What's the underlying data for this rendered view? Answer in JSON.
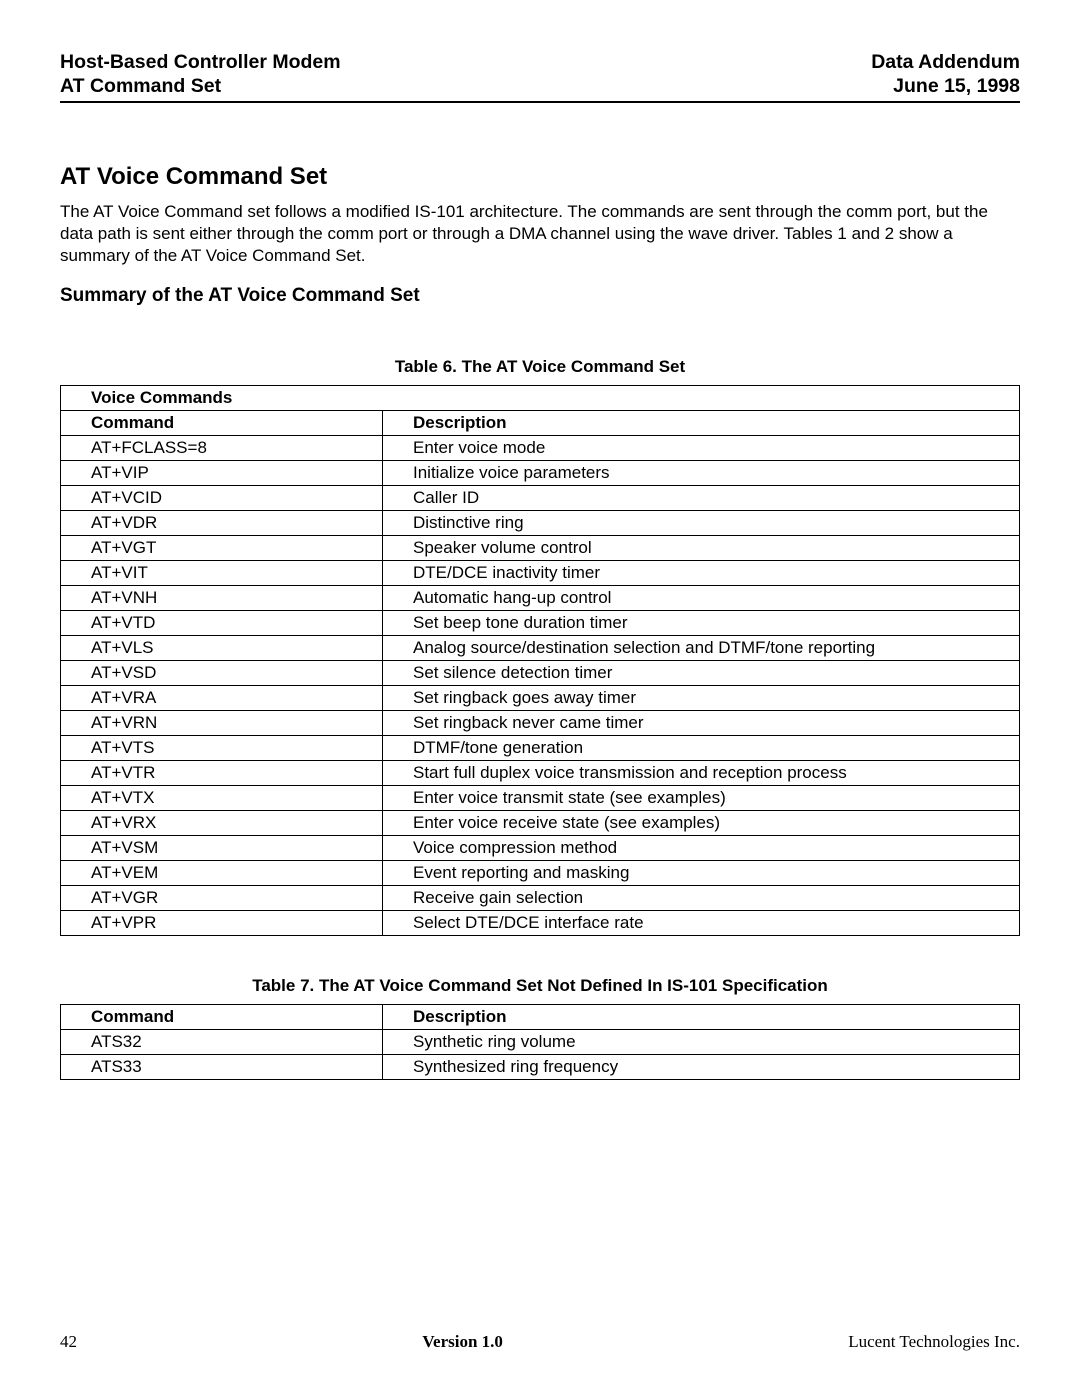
{
  "header": {
    "left_line1": "Host-Based Controller Modem",
    "left_line2": "AT Command Set",
    "right_line1": "Data Addendum",
    "right_line2": "June 15, 1998"
  },
  "section_title": "AT Voice Command Set",
  "intro_text": "The AT Voice Command set follows a modified IS-101 architecture.  The commands are sent through the comm port, but the data path is sent either through the comm port or through a DMA channel using the wave driver.  Tables 1 and 2 show a summary of the AT Voice Command Set.",
  "subsection_title": "Summary of the AT Voice Command Set",
  "table6": {
    "caption": "Table 6.  The AT Voice Command Set",
    "title_row": "Voice Commands",
    "col1": "Command",
    "col2": "Description",
    "rows": [
      {
        "cmd": "AT+FCLASS=8",
        "desc": "Enter voice mode"
      },
      {
        "cmd": "AT+VIP",
        "desc": "Initialize voice parameters"
      },
      {
        "cmd": "AT+VCID",
        "desc": "Caller ID"
      },
      {
        "cmd": "AT+VDR",
        "desc": "Distinctive ring"
      },
      {
        "cmd": "AT+VGT",
        "desc": "Speaker volume control"
      },
      {
        "cmd": "AT+VIT",
        "desc": "DTE/DCE inactivity timer"
      },
      {
        "cmd": "AT+VNH",
        "desc": "Automatic hang-up control"
      },
      {
        "cmd": "AT+VTD",
        "desc": "Set beep tone duration timer"
      },
      {
        "cmd": "AT+VLS",
        "desc": "Analog source/destination selection and DTMF/tone reporting"
      },
      {
        "cmd": "AT+VSD",
        "desc": "Set silence detection timer"
      },
      {
        "cmd": "AT+VRA",
        "desc": "Set ringback goes away timer"
      },
      {
        "cmd": "AT+VRN",
        "desc": "Set ringback never came timer"
      },
      {
        "cmd": "AT+VTS",
        "desc": "DTMF/tone generation"
      },
      {
        "cmd": "AT+VTR",
        "desc": "Start full duplex voice transmission and reception process"
      },
      {
        "cmd": "AT+VTX",
        "desc": "Enter voice transmit state (see examples)"
      },
      {
        "cmd": "AT+VRX",
        "desc": "Enter voice receive state (see examples)"
      },
      {
        "cmd": "AT+VSM",
        "desc": "Voice compression method"
      },
      {
        "cmd": "AT+VEM",
        "desc": "Event reporting and masking"
      },
      {
        "cmd": "AT+VGR",
        "desc": "Receive gain selection"
      },
      {
        "cmd": "AT+VPR",
        "desc": "Select DTE/DCE interface rate"
      }
    ]
  },
  "table7": {
    "caption": "Table 7.  The AT Voice Command Set Not Defined In IS-101 Specification",
    "col1": "Command",
    "col2": "Description",
    "rows": [
      {
        "cmd": "ATS32",
        "desc": "Synthetic ring volume"
      },
      {
        "cmd": "ATS33",
        "desc": "Synthesized ring frequency"
      }
    ]
  },
  "footer": {
    "page": "42",
    "version": "Version 1.0",
    "company": "Lucent Technologies Inc."
  }
}
